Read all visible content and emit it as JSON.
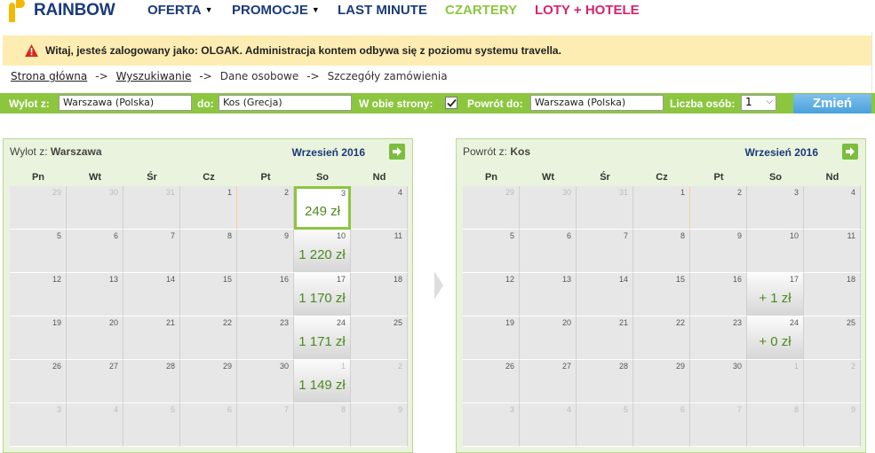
{
  "nav": {
    "logo": "RAINBOW",
    "items": [
      {
        "label": "OFERTA",
        "color": "#1a3a7a",
        "caret": "▼"
      },
      {
        "label": "PROMOCJE",
        "color": "#1a3a7a",
        "caret": "▼"
      },
      {
        "label": "LAST MINUTE",
        "color": "#1a3a7a",
        "caret": ""
      },
      {
        "label": "CZARTERY",
        "color": "#8cc63f",
        "caret": ""
      },
      {
        "label": "LOTY + HOTELE",
        "color": "#d6246e",
        "caret": ""
      }
    ]
  },
  "alert": {
    "text": "Witaj, jesteś zalogowany jako: OLGAK. Administracja kontem odbywa się z poziomu systemu travella."
  },
  "breadcrumb": {
    "items": [
      "Strona główna",
      "Wyszukiwanie",
      "Dane osobowe",
      "Szczegóły zamówienia"
    ],
    "separator": "->"
  },
  "search": {
    "from_label": "Wylot z:",
    "from_value": "Warszawa (Polska)",
    "to_label": "do:",
    "to_value": "Kos (Grecja)",
    "roundtrip_label": "W obie strony:",
    "roundtrip_checked": true,
    "return_label": "Powrót do:",
    "return_value": "Warszawa (Polska)",
    "persons_label": "Liczba osób:",
    "persons_value": "1",
    "submit_label": "Zmień"
  },
  "weekdays": [
    "Pn",
    "Wt",
    "Śr",
    "Cz",
    "Pt",
    "So",
    "Nd"
  ],
  "calendars": [
    {
      "title_prefix": "Wylot z:",
      "title_city": "Warszawa",
      "month": "Wrzesień 2016",
      "weeks": [
        [
          {
            "d": "29",
            "dim": true
          },
          {
            "d": "30",
            "dim": true
          },
          {
            "d": "31",
            "dim": true
          },
          {
            "d": "1"
          },
          {
            "d": "2"
          },
          {
            "d": "3",
            "p": "249 zł",
            "sel": true
          },
          {
            "d": "4"
          }
        ],
        [
          {
            "d": "5"
          },
          {
            "d": "6"
          },
          {
            "d": "7"
          },
          {
            "d": "8"
          },
          {
            "d": "9"
          },
          {
            "d": "10",
            "p": "1 220 zł"
          },
          {
            "d": "11"
          }
        ],
        [
          {
            "d": "12"
          },
          {
            "d": "13"
          },
          {
            "d": "14"
          },
          {
            "d": "15"
          },
          {
            "d": "16"
          },
          {
            "d": "17",
            "p": "1 170 zł"
          },
          {
            "d": "18"
          }
        ],
        [
          {
            "d": "19"
          },
          {
            "d": "20"
          },
          {
            "d": "21"
          },
          {
            "d": "22"
          },
          {
            "d": "23"
          },
          {
            "d": "24",
            "p": "1 171 zł"
          },
          {
            "d": "25"
          }
        ],
        [
          {
            "d": "26"
          },
          {
            "d": "27"
          },
          {
            "d": "28"
          },
          {
            "d": "29"
          },
          {
            "d": "30"
          },
          {
            "d": "1",
            "p": "1 149 zł",
            "dim": true
          },
          {
            "d": "2",
            "dim": true
          }
        ],
        [
          {
            "d": "3",
            "dim": true
          },
          {
            "d": "4",
            "dim": true
          },
          {
            "d": "5",
            "dim": true
          },
          {
            "d": "6",
            "dim": true
          },
          {
            "d": "7",
            "dim": true
          },
          {
            "d": "8",
            "dim": true
          },
          {
            "d": "9",
            "dim": true
          }
        ]
      ]
    },
    {
      "title_prefix": "Powrót z:",
      "title_city": "Kos",
      "month": "Wrzesień 2016",
      "weeks": [
        [
          {
            "d": "29",
            "dim": true
          },
          {
            "d": "30",
            "dim": true
          },
          {
            "d": "31",
            "dim": true
          },
          {
            "d": "1"
          },
          {
            "d": "2"
          },
          {
            "d": "3"
          },
          {
            "d": "4"
          }
        ],
        [
          {
            "d": "5"
          },
          {
            "d": "6"
          },
          {
            "d": "7"
          },
          {
            "d": "8"
          },
          {
            "d": "9"
          },
          {
            "d": "10"
          },
          {
            "d": "11"
          }
        ],
        [
          {
            "d": "12"
          },
          {
            "d": "13"
          },
          {
            "d": "14"
          },
          {
            "d": "15"
          },
          {
            "d": "16"
          },
          {
            "d": "17",
            "p": "+ 1 zł"
          },
          {
            "d": "18"
          }
        ],
        [
          {
            "d": "19"
          },
          {
            "d": "20"
          },
          {
            "d": "21"
          },
          {
            "d": "22"
          },
          {
            "d": "23"
          },
          {
            "d": "24",
            "p": "+ 0 zł"
          },
          {
            "d": "25"
          }
        ],
        [
          {
            "d": "26"
          },
          {
            "d": "27"
          },
          {
            "d": "28"
          },
          {
            "d": "29"
          },
          {
            "d": "30"
          },
          {
            "d": "1",
            "dim": true
          },
          {
            "d": "2",
            "dim": true
          }
        ],
        [
          {
            "d": "3",
            "dim": true
          },
          {
            "d": "4",
            "dim": true
          },
          {
            "d": "5",
            "dim": true
          },
          {
            "d": "6",
            "dim": true
          },
          {
            "d": "7",
            "dim": true
          },
          {
            "d": "8",
            "dim": true
          },
          {
            "d": "9",
            "dim": true
          }
        ]
      ]
    }
  ]
}
